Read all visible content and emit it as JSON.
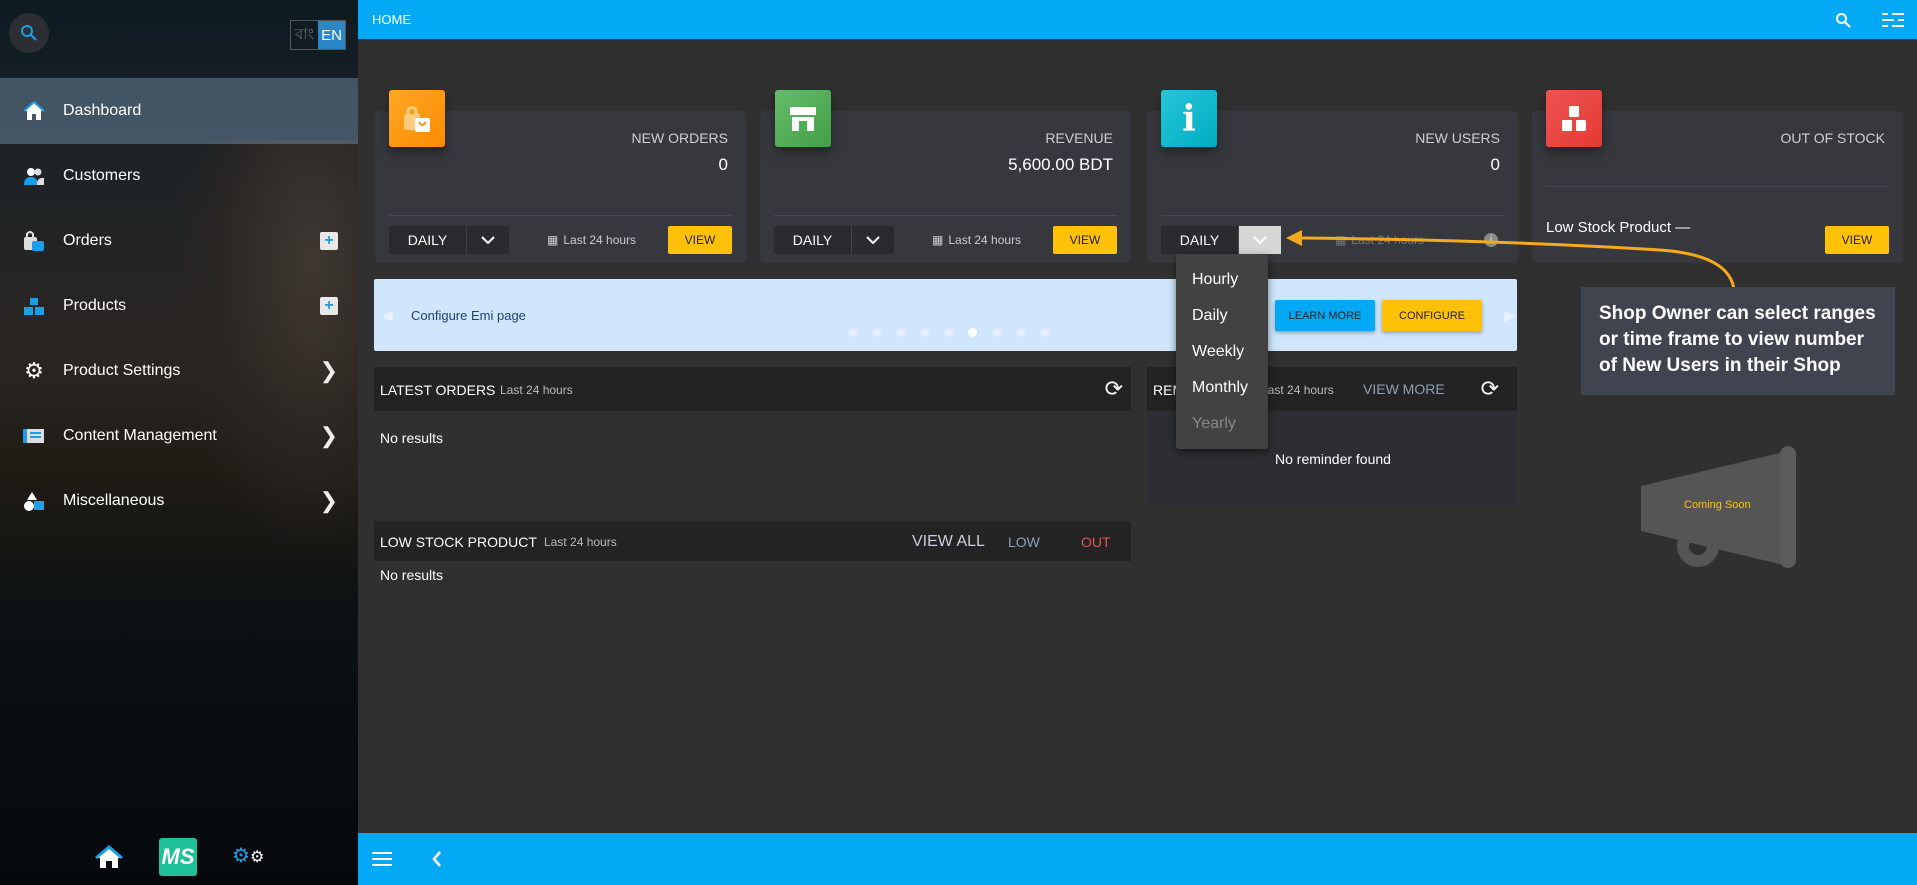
{
  "sidebar": {
    "lang": {
      "bn": "বাং",
      "en": "EN"
    },
    "items": [
      {
        "label": "Dashboard",
        "icon": "home-icon",
        "active": true
      },
      {
        "label": "Customers",
        "icon": "customers-icon"
      },
      {
        "label": "Orders",
        "icon": "orders-bag-icon",
        "action": "plus"
      },
      {
        "label": "Products",
        "icon": "boxes-icon",
        "action": "plus"
      },
      {
        "label": "Product Settings",
        "icon": "gear-icon",
        "action": "chevron"
      },
      {
        "label": "Content Management",
        "icon": "newspaper-icon",
        "action": "chevron"
      },
      {
        "label": "Miscellaneous",
        "icon": "shapes-icon",
        "action": "chevron"
      }
    ],
    "footer": {
      "logo": "MS"
    }
  },
  "topbar": {
    "title": "HOME"
  },
  "cards": [
    {
      "title": "NEW ORDERS",
      "value": "0",
      "range": "DAILY",
      "period": "Last 24 hours",
      "view": "VIEW",
      "color": "#ff9800"
    },
    {
      "title": "REVENUE",
      "value": "5,600.00 BDT",
      "range": "DAILY",
      "period": "Last 24 hours",
      "view": "VIEW",
      "color": "#4caf50"
    },
    {
      "title": "NEW USERS",
      "value": "0",
      "range": "DAILY",
      "period": "Last 24 hours",
      "color": "#00bcd4"
    },
    {
      "title": "OUT OF STOCK",
      "text": "Low Stock Product —",
      "view": "VIEW",
      "color": "#e53935"
    }
  ],
  "range_menu": {
    "options": [
      "Hourly",
      "Daily",
      "Weekly",
      "Monthly",
      "Yearly"
    ],
    "disabled": "Yearly"
  },
  "banner": {
    "text": "Configure Emi page",
    "learn_more": "LEARN MORE",
    "configure": "CONFIGURE",
    "slides": 9,
    "active_slide": 6
  },
  "latest_orders": {
    "title": "LATEST ORDERS",
    "period": "Last 24 hours",
    "empty": "No results"
  },
  "reminders": {
    "title": "REMINDERS",
    "period": "Last 24 hours",
    "view_more": "VIEW MORE",
    "empty": "No reminder found"
  },
  "low_stock": {
    "title": "LOW STOCK PRODUCT",
    "period": "Last 24 hours",
    "view_all": "VIEW ALL",
    "low": "LOW",
    "out": "OUT",
    "empty": "No results"
  },
  "coming_soon": "Coming Soon",
  "callout": "Shop Owner can select ranges or time frame to view number of New Users in their Shop"
}
